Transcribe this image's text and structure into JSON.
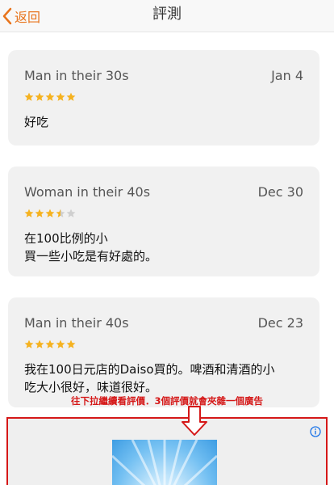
{
  "nav": {
    "back_label": "返回",
    "title": "評測"
  },
  "reviews": [
    {
      "reviewer": "Man in their 30s",
      "date": "Jan 4",
      "rating": 5,
      "text": "好吃"
    },
    {
      "reviewer": "Woman in their 40s",
      "date": "Dec 30",
      "rating": 3.5,
      "text": "在100比例的小\n買一些小吃是有好處的。"
    },
    {
      "reviewer": "Man in their 40s",
      "date": "Dec 23",
      "rating": 5,
      "text": "我在100日元店的Daiso買的。啤酒和清酒的小\n吃大小很好，味道很好。"
    }
  ],
  "annotation": "往下拉繼續看評價．3個評價就會夾雜一個廣告",
  "colors": {
    "accent": "#e8741c",
    "star": "#f5b220",
    "star_empty": "#cfcfcf",
    "annotation": "#d51818"
  },
  "icons": {
    "back": "chevron-left-icon",
    "star": "star-icon",
    "arrow": "down-arrow-icon",
    "ad_info": "info-icon"
  }
}
